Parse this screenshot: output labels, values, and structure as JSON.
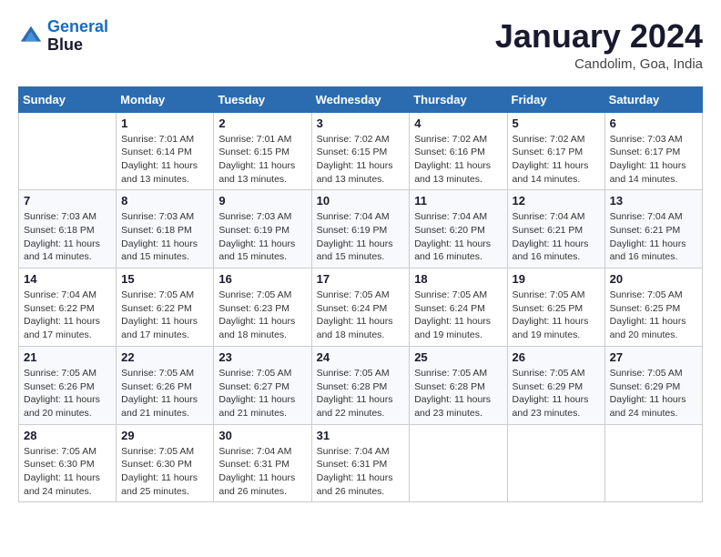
{
  "header": {
    "logo_line1": "General",
    "logo_line2": "Blue",
    "month_title": "January 2024",
    "subtitle": "Candolim, Goa, India"
  },
  "weekdays": [
    "Sunday",
    "Monday",
    "Tuesday",
    "Wednesday",
    "Thursday",
    "Friday",
    "Saturday"
  ],
  "weeks": [
    [
      {
        "day": "",
        "sunrise": "",
        "sunset": "",
        "daylight": ""
      },
      {
        "day": "1",
        "sunrise": "7:01 AM",
        "sunset": "6:14 PM",
        "daylight": "11 hours and 13 minutes."
      },
      {
        "day": "2",
        "sunrise": "7:01 AM",
        "sunset": "6:15 PM",
        "daylight": "11 hours and 13 minutes."
      },
      {
        "day": "3",
        "sunrise": "7:02 AM",
        "sunset": "6:15 PM",
        "daylight": "11 hours and 13 minutes."
      },
      {
        "day": "4",
        "sunrise": "7:02 AM",
        "sunset": "6:16 PM",
        "daylight": "11 hours and 13 minutes."
      },
      {
        "day": "5",
        "sunrise": "7:02 AM",
        "sunset": "6:17 PM",
        "daylight": "11 hours and 14 minutes."
      },
      {
        "day": "6",
        "sunrise": "7:03 AM",
        "sunset": "6:17 PM",
        "daylight": "11 hours and 14 minutes."
      }
    ],
    [
      {
        "day": "7",
        "sunrise": "7:03 AM",
        "sunset": "6:18 PM",
        "daylight": "11 hours and 14 minutes."
      },
      {
        "day": "8",
        "sunrise": "7:03 AM",
        "sunset": "6:18 PM",
        "daylight": "11 hours and 15 minutes."
      },
      {
        "day": "9",
        "sunrise": "7:03 AM",
        "sunset": "6:19 PM",
        "daylight": "11 hours and 15 minutes."
      },
      {
        "day": "10",
        "sunrise": "7:04 AM",
        "sunset": "6:19 PM",
        "daylight": "11 hours and 15 minutes."
      },
      {
        "day": "11",
        "sunrise": "7:04 AM",
        "sunset": "6:20 PM",
        "daylight": "11 hours and 16 minutes."
      },
      {
        "day": "12",
        "sunrise": "7:04 AM",
        "sunset": "6:21 PM",
        "daylight": "11 hours and 16 minutes."
      },
      {
        "day": "13",
        "sunrise": "7:04 AM",
        "sunset": "6:21 PM",
        "daylight": "11 hours and 16 minutes."
      }
    ],
    [
      {
        "day": "14",
        "sunrise": "7:04 AM",
        "sunset": "6:22 PM",
        "daylight": "11 hours and 17 minutes."
      },
      {
        "day": "15",
        "sunrise": "7:05 AM",
        "sunset": "6:22 PM",
        "daylight": "11 hours and 17 minutes."
      },
      {
        "day": "16",
        "sunrise": "7:05 AM",
        "sunset": "6:23 PM",
        "daylight": "11 hours and 18 minutes."
      },
      {
        "day": "17",
        "sunrise": "7:05 AM",
        "sunset": "6:24 PM",
        "daylight": "11 hours and 18 minutes."
      },
      {
        "day": "18",
        "sunrise": "7:05 AM",
        "sunset": "6:24 PM",
        "daylight": "11 hours and 19 minutes."
      },
      {
        "day": "19",
        "sunrise": "7:05 AM",
        "sunset": "6:25 PM",
        "daylight": "11 hours and 19 minutes."
      },
      {
        "day": "20",
        "sunrise": "7:05 AM",
        "sunset": "6:25 PM",
        "daylight": "11 hours and 20 minutes."
      }
    ],
    [
      {
        "day": "21",
        "sunrise": "7:05 AM",
        "sunset": "6:26 PM",
        "daylight": "11 hours and 20 minutes."
      },
      {
        "day": "22",
        "sunrise": "7:05 AM",
        "sunset": "6:26 PM",
        "daylight": "11 hours and 21 minutes."
      },
      {
        "day": "23",
        "sunrise": "7:05 AM",
        "sunset": "6:27 PM",
        "daylight": "11 hours and 21 minutes."
      },
      {
        "day": "24",
        "sunrise": "7:05 AM",
        "sunset": "6:28 PM",
        "daylight": "11 hours and 22 minutes."
      },
      {
        "day": "25",
        "sunrise": "7:05 AM",
        "sunset": "6:28 PM",
        "daylight": "11 hours and 23 minutes."
      },
      {
        "day": "26",
        "sunrise": "7:05 AM",
        "sunset": "6:29 PM",
        "daylight": "11 hours and 23 minutes."
      },
      {
        "day": "27",
        "sunrise": "7:05 AM",
        "sunset": "6:29 PM",
        "daylight": "11 hours and 24 minutes."
      }
    ],
    [
      {
        "day": "28",
        "sunrise": "7:05 AM",
        "sunset": "6:30 PM",
        "daylight": "11 hours and 24 minutes."
      },
      {
        "day": "29",
        "sunrise": "7:05 AM",
        "sunset": "6:30 PM",
        "daylight": "11 hours and 25 minutes."
      },
      {
        "day": "30",
        "sunrise": "7:04 AM",
        "sunset": "6:31 PM",
        "daylight": "11 hours and 26 minutes."
      },
      {
        "day": "31",
        "sunrise": "7:04 AM",
        "sunset": "6:31 PM",
        "daylight": "11 hours and 26 minutes."
      },
      {
        "day": "",
        "sunrise": "",
        "sunset": "",
        "daylight": ""
      },
      {
        "day": "",
        "sunrise": "",
        "sunset": "",
        "daylight": ""
      },
      {
        "day": "",
        "sunrise": "",
        "sunset": "",
        "daylight": ""
      }
    ]
  ],
  "labels": {
    "sunrise_prefix": "Sunrise: ",
    "sunset_prefix": "Sunset: ",
    "daylight_prefix": "Daylight: "
  }
}
